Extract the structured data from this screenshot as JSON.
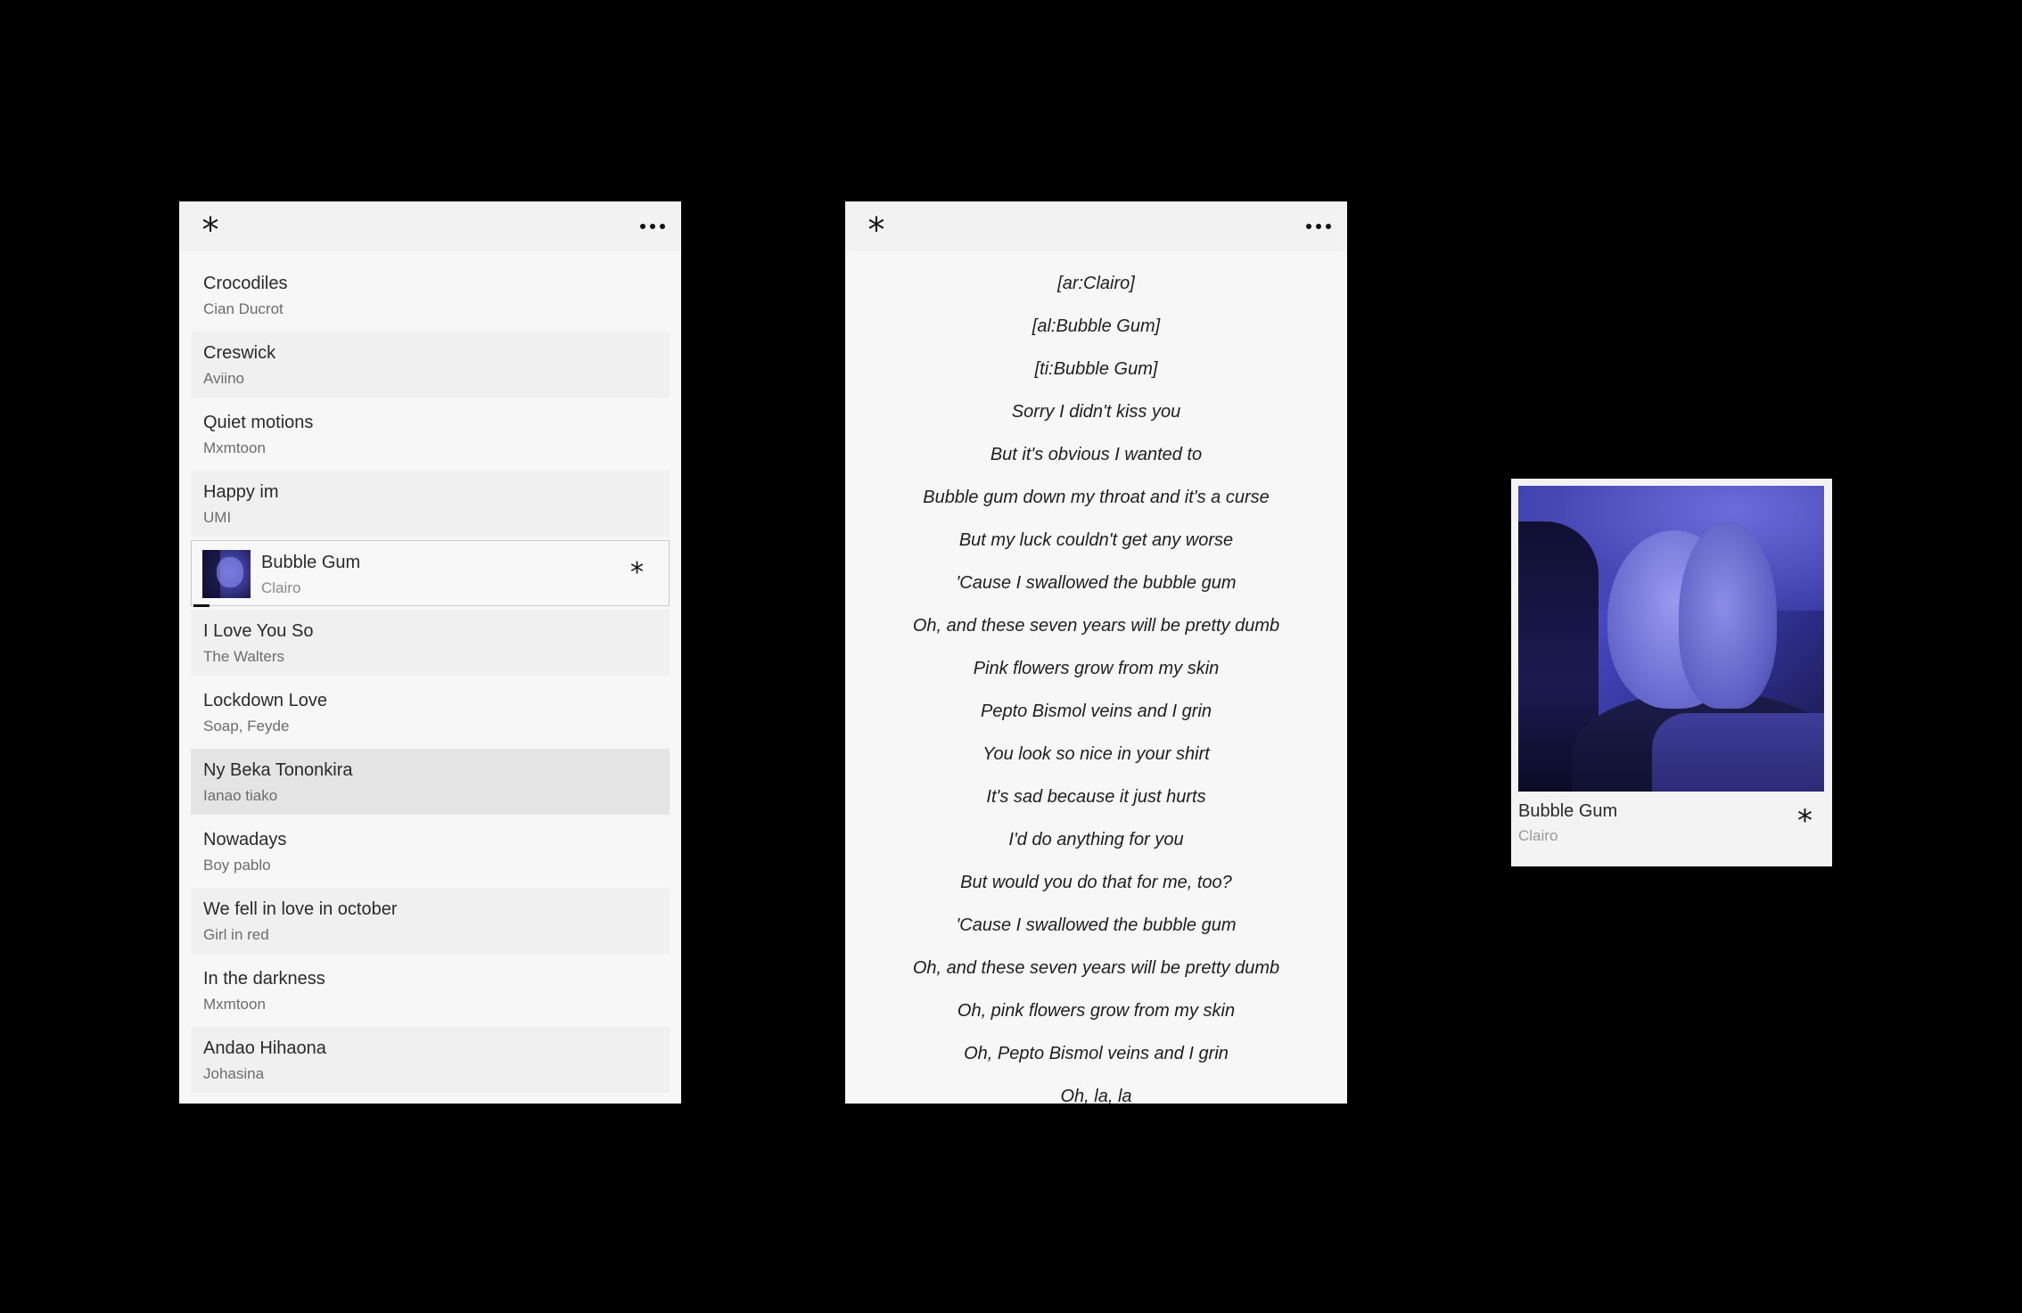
{
  "playlist_panel": {
    "menu_icon": "asterisk-icon",
    "more_icon": "more-horizontal-icon",
    "tracks": [
      {
        "title": "Crocodiles",
        "artist": "Cian Ducrot"
      },
      {
        "title": "Creswick",
        "artist": "Aviino"
      },
      {
        "title": "Quiet motions",
        "artist": "Mxmtoon"
      },
      {
        "title": "Happy im",
        "artist": "UMI"
      },
      {
        "title": "Bubble Gum",
        "artist": "Clairo",
        "current": true
      },
      {
        "title": "I Love You So",
        "artist": "The Walters"
      },
      {
        "title": "Lockdown Love",
        "artist": "Soap, Feyde"
      },
      {
        "title": "Ny Beka Tononkira",
        "artist": "Ianao tiako"
      },
      {
        "title": "Nowadays",
        "artist": "Boy pablo"
      },
      {
        "title": "We fell in love in october",
        "artist": "Girl in red"
      },
      {
        "title": "In the darkness",
        "artist": "Mxmtoon"
      },
      {
        "title": "Andao Hihaona",
        "artist": "Johasina"
      }
    ]
  },
  "lyrics_panel": {
    "menu_icon": "asterisk-icon",
    "more_icon": "more-horizontal-icon",
    "lines": [
      "[ar:Clairo]",
      "[al:Bubble Gum]",
      "[ti:Bubble Gum]",
      "Sorry I didn't kiss you",
      "But it's obvious I wanted to",
      "Bubble gum down my throat and it's a curse",
      "But my luck couldn't get any worse",
      "'Cause I swallowed the bubble gum",
      "Oh, and these seven years will be pretty dumb",
      "Pink flowers grow from my skin",
      "Pepto Bismol veins and I grin",
      "You look so nice in your shirt",
      "It's sad because it just hurts",
      "I'd do anything for you",
      "But would you do that for me, too?",
      "'Cause I swallowed the bubble gum",
      "Oh, and these seven years will be pretty dumb",
      "Oh, pink flowers grow from my skin",
      "Oh, Pepto Bismol veins and I grin",
      "Oh, la, la"
    ]
  },
  "now_playing": {
    "title": "Bubble Gum",
    "artist": "Clairo",
    "action_icon": "asterisk-icon"
  },
  "colors": {
    "background": "#000000",
    "panel": "#f7f7f7",
    "panel_alt": "#f0f0f0",
    "row_hover": "#e4e4e4",
    "cover_tint": "#4848c2"
  }
}
